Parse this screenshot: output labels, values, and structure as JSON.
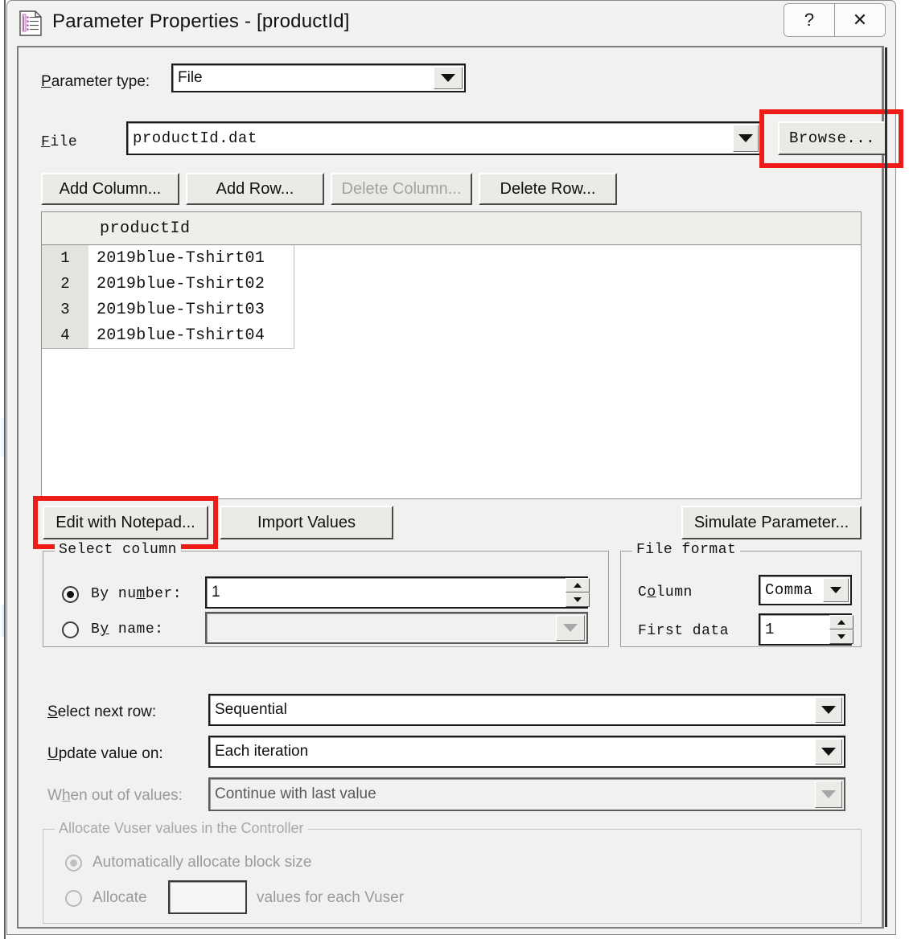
{
  "window": {
    "title": "Parameter Properties - [productId]",
    "icon": "parameter-file-icon",
    "help_button": "?",
    "close_button": "✕"
  },
  "parameter_type": {
    "label": "Parameter type:",
    "label_accel": "P",
    "value": "File"
  },
  "file_row": {
    "label": "File",
    "label_accel": "F",
    "value": "productId.dat",
    "browse_label": "Browse...",
    "browse_accel": "B",
    "highlighted": true,
    "highlight_color": "#ee1c18"
  },
  "grid_buttons": [
    {
      "label": "Add Column...",
      "accel": "A",
      "enabled": true
    },
    {
      "label": "Add Row...",
      "accel": "R",
      "enabled": true
    },
    {
      "label": "Delete Column...",
      "accel": "D",
      "enabled": false
    },
    {
      "label": "Delete Row...",
      "accel": "e",
      "enabled": true
    }
  ],
  "table": {
    "columns": [
      "productId",
      ""
    ],
    "rows": [
      {
        "num": "1",
        "values": [
          "2019blue-Tshirt01"
        ]
      },
      {
        "num": "2",
        "values": [
          "2019blue-Tshirt02"
        ]
      },
      {
        "num": "3",
        "values": [
          "2019blue-Tshirt03"
        ]
      },
      {
        "num": "4",
        "values": [
          "2019blue-Tshirt04"
        ]
      }
    ]
  },
  "action_buttons": {
    "edit_notepad": "Edit with Notepad...",
    "edit_notepad_accel": "E",
    "edit_notepad_highlighted": true,
    "import_values": "Import Values",
    "simulate_parameter": "Simulate Parameter...",
    "simulate_accel": "S"
  },
  "select_column": {
    "group_title": "Select column",
    "by_number_label": "By number:",
    "by_number_selected": true,
    "by_number_value": "1",
    "by_name_label": "By name:",
    "by_name_selected": false,
    "by_name_value": ""
  },
  "file_format": {
    "group_title": "File format",
    "column_label": "Column",
    "column_value": "Comma",
    "first_data_label": "First data",
    "first_data_value": "1"
  },
  "row_options": [
    {
      "label": "Select next row:",
      "accel": "S",
      "value": "Sequential",
      "enabled": true
    },
    {
      "label": "Update value on:",
      "accel": "U",
      "value": "Each iteration",
      "enabled": true
    },
    {
      "label": "When out of values:",
      "accel": "h",
      "value": "Continue with last value",
      "enabled": false
    }
  ],
  "allocate_group": {
    "title": "Allocate Vuser values in the Controller",
    "enabled": false,
    "auto_label": "Automatically allocate block size",
    "auto_selected": true,
    "allocate_label": "Allocate",
    "allocate_value": "",
    "allocate_suffix": "values for each Vuser"
  }
}
